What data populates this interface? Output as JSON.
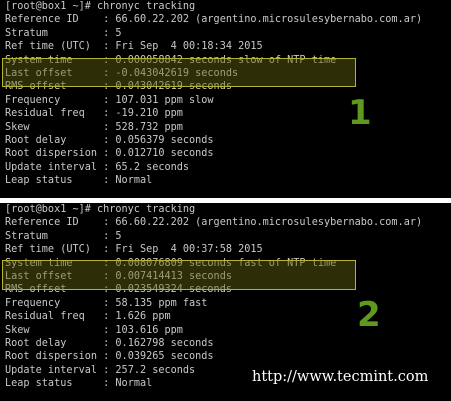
{
  "terminals": [
    {
      "prompt": "[root@box1 ~]# chronyc tracking",
      "rows": [
        {
          "label": "Reference ID    ",
          "value": "66.60.22.202 (argentino.microsulesybernabo.com.ar)"
        },
        {
          "label": "Stratum         ",
          "value": "5"
        },
        {
          "label": "Ref time (UTC)  ",
          "value": "Fri Sep  4 00:18:34 2015"
        },
        {
          "label": "System time     ",
          "value": "0.000058842 seconds slow of NTP time"
        },
        {
          "label": "Last offset     ",
          "value": "-0.043042619 seconds"
        },
        {
          "label": "RMS offset      ",
          "value": "0.043042619 seconds"
        },
        {
          "label": "Frequency       ",
          "value": "107.031 ppm slow"
        },
        {
          "label": "Residual freq   ",
          "value": "-19.210 ppm"
        },
        {
          "label": "Skew            ",
          "value": "528.732 ppm"
        },
        {
          "label": "Root delay      ",
          "value": "0.056379 seconds"
        },
        {
          "label": "Root dispersion ",
          "value": "0.012710 seconds"
        },
        {
          "label": "Update interval ",
          "value": "65.2 seconds"
        },
        {
          "label": "Leap status     ",
          "value": "Normal"
        }
      ],
      "badge": "1"
    },
    {
      "prompt": "[root@box1 ~]# chronyc tracking",
      "rows": [
        {
          "label": "Reference ID    ",
          "value": "66.60.22.202 (argentino.microsulesybernabo.com.ar)"
        },
        {
          "label": "Stratum         ",
          "value": "5"
        },
        {
          "label": "Ref time (UTC)  ",
          "value": "Fri Sep  4 00:37:58 2015"
        },
        {
          "label": "System time     ",
          "value": "0.008076809 seconds fast of NTP time"
        },
        {
          "label": "Last offset     ",
          "value": "0.007414413 seconds"
        },
        {
          "label": "RMS offset      ",
          "value": "0.023549324 seconds"
        },
        {
          "label": "Frequency       ",
          "value": "58.135 ppm fast"
        },
        {
          "label": "Residual freq   ",
          "value": "1.626 ppm"
        },
        {
          "label": "Skew            ",
          "value": "103.616 ppm"
        },
        {
          "label": "Root delay      ",
          "value": "0.162798 seconds"
        },
        {
          "label": "Root dispersion ",
          "value": "0.039265 seconds"
        },
        {
          "label": "Update interval ",
          "value": "257.2 seconds"
        },
        {
          "label": "Leap status     ",
          "value": "Normal"
        }
      ],
      "badge": "2",
      "watermark": "http://www.tecmint.com"
    }
  ],
  "colors": {
    "highlight_border": "#b5b52b",
    "badge": "#5e9a1f",
    "text": "#c8c8c8",
    "background": "#000000"
  }
}
